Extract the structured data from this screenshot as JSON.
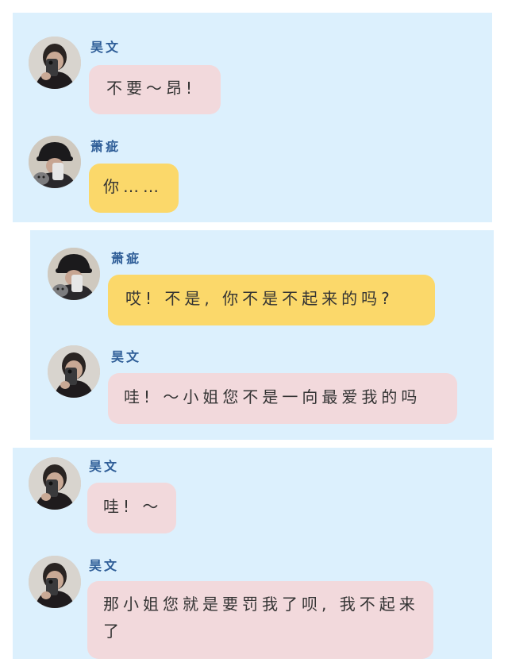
{
  "panels": [
    {
      "messages": [
        {
          "sender": "昊文",
          "avatar": "avatar-haowen",
          "text": "不要～昂!",
          "bubble_color": "#f2d9dc"
        },
        {
          "sender": "萧疵",
          "avatar": "avatar-xiaoci",
          "text": "你……",
          "bubble_color": "#fbd86a"
        }
      ]
    },
    {
      "messages": [
        {
          "sender": "萧疵",
          "avatar": "avatar-xiaoci",
          "text": "哎! 不是, 你不是不起来的吗?",
          "bubble_color": "#fbd86a"
        },
        {
          "sender": "昊文",
          "avatar": "avatar-haowen",
          "text": "哇! ～小姐您不是一向最爱我的吗",
          "bubble_color": "#f2d9dc"
        }
      ]
    },
    {
      "messages": [
        {
          "sender": "昊文",
          "avatar": "avatar-haowen",
          "text": "哇! ～",
          "bubble_color": "#f2d9dc"
        },
        {
          "sender": "昊文",
          "avatar": "avatar-haowen",
          "text": "那小姐您就是要罚我了呗, 我不起来了",
          "bubble_color": "#f2d9dc"
        }
      ]
    }
  ],
  "colors": {
    "panel_background": "#dcf0fd",
    "name_text": "#2f5e98",
    "pink_bubble": "#f2d9dc",
    "yellow_bubble": "#fbd86a"
  }
}
